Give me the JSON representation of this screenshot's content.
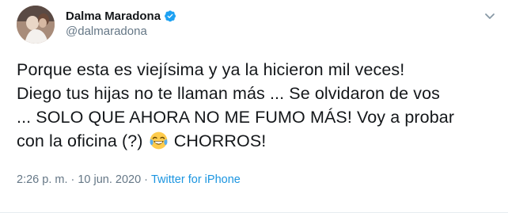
{
  "tweet": {
    "author": {
      "display_name": "Dalma Maradona",
      "handle": "@dalmaradona",
      "verified": true,
      "avatar_icon": "profile-photo"
    },
    "text_lines": {
      "line1": "Porque esta es viejísima y ya la hicieron mil veces!",
      "line2": "Diego tus hijas no te llaman más ... Se olvidaron de vos",
      "line3": "... SOLO QUE AHORA NO ME FUMO MÁS! Voy a probar",
      "line4_before_emoji": "con la oficina (?)",
      "line4_after_emoji": "CHORROS!"
    },
    "emoji": "face-with-tears-of-joy",
    "meta": {
      "time": "2:26 p. m.",
      "separator": "·",
      "date": "10 jun. 2020",
      "separator2": "·",
      "source": "Twitter for iPhone"
    },
    "colors": {
      "text": "#14171a",
      "secondary": "#657786",
      "link": "#1b95e0",
      "verified": "#1da1f2"
    }
  }
}
